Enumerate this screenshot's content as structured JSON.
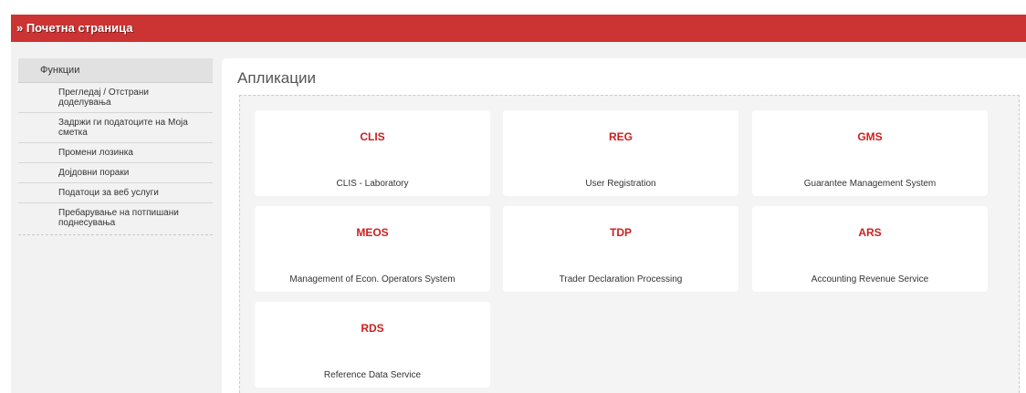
{
  "header": {
    "title": "» Почетна страница"
  },
  "sidebar": {
    "title": "Функции",
    "items": [
      {
        "label": "Прегледај / Отстрани доделувања"
      },
      {
        "label": "Задржи ги податоците на Моја сметка"
      },
      {
        "label": "Промени лозинка"
      },
      {
        "label": "Дојдовни пораки"
      },
      {
        "label": "Податоци за веб услуги"
      },
      {
        "label": "Пребарување на потпишани поднесувања"
      }
    ]
  },
  "main": {
    "title": "Апликации",
    "apps": [
      {
        "code": "CLIS",
        "name": "CLIS - Laboratory"
      },
      {
        "code": "REG",
        "name": "User Registration"
      },
      {
        "code": "GMS",
        "name": "Guarantee Management System"
      },
      {
        "code": "MEOS",
        "name": "Management of Econ. Operators System"
      },
      {
        "code": "TDP",
        "name": "Trader Declaration Processing"
      },
      {
        "code": "ARS",
        "name": "Accounting Revenue Service"
      },
      {
        "code": "RDS",
        "name": "Reference Data Service"
      }
    ]
  },
  "colors": {
    "header_bg": "#cc3333",
    "app_code": "#cc1f1f",
    "page_bg": "#f2f2f2"
  }
}
